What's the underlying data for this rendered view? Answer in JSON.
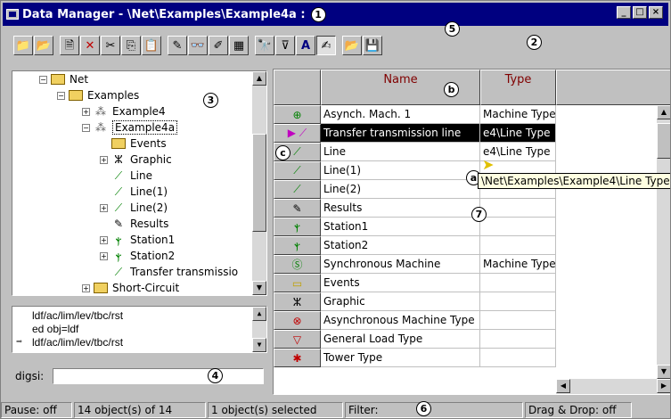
{
  "window": {
    "title": "Data Manager - \\Net\\Examples\\Example4a :",
    "title_callout": "1",
    "controls": [
      "_",
      "□",
      "×"
    ]
  },
  "toolbar": {
    "buttons": [
      {
        "icon": "folder-up-icon",
        "glyph": "📁"
      },
      {
        "icon": "folder-open-icon",
        "glyph": "📂"
      },
      {
        "icon": "new-object-icon",
        "glyph": "🗎"
      },
      {
        "icon": "delete-icon",
        "glyph": "✕"
      },
      {
        "icon": "cut-icon",
        "glyph": "✂"
      },
      {
        "icon": "copy-icon",
        "glyph": "⎘"
      },
      {
        "icon": "paste-icon",
        "glyph": "📋"
      },
      {
        "icon": "edit-icon",
        "glyph": "✎"
      },
      {
        "icon": "detail-view-icon",
        "glyph": "👓"
      },
      {
        "icon": "edit-relevant-icon",
        "glyph": "✐"
      },
      {
        "icon": "calendar-icon",
        "glyph": "▦"
      },
      {
        "icon": "binoculars-icon",
        "glyph": "🔭"
      },
      {
        "icon": "filter-icon",
        "glyph": "⊽"
      },
      {
        "icon": "font-icon",
        "glyph": "A"
      },
      {
        "icon": "script-icon",
        "glyph": "✍"
      },
      {
        "icon": "open-file-icon",
        "glyph": "📂"
      },
      {
        "icon": "save-icon",
        "glyph": "💾"
      }
    ],
    "callout_5": "5",
    "callout_2": "2"
  },
  "tree": {
    "callout": "3",
    "items": [
      {
        "label": "Net",
        "pm": "−",
        "icon": "folder"
      },
      {
        "label": "Examples",
        "pm": "−",
        "icon": "folder"
      },
      {
        "label": "Example4",
        "pm": "+",
        "icon": "grid-icon"
      },
      {
        "label": "Example4a",
        "pm": "−",
        "icon": "grid-icon"
      },
      {
        "label": "Events",
        "pm": "",
        "icon": "folder"
      },
      {
        "label": "Graphic",
        "pm": "+",
        "icon": "graphic-icon"
      },
      {
        "label": "Line",
        "pm": "",
        "icon": "line-icon"
      },
      {
        "label": "Line(1)",
        "pm": "",
        "icon": "line-icon"
      },
      {
        "label": "Line(2)",
        "pm": "+",
        "icon": "line-icon"
      },
      {
        "label": "Results",
        "pm": "",
        "icon": "results-icon"
      },
      {
        "label": "Station1",
        "pm": "+",
        "icon": "station-icon"
      },
      {
        "label": "Station2",
        "pm": "+",
        "icon": "station-icon"
      },
      {
        "label": "Transfer transmissio",
        "pm": "",
        "icon": "line-icon"
      },
      {
        "label": "Short-Circuit",
        "pm": "+",
        "icon": "folder"
      }
    ]
  },
  "command": {
    "lines": [
      "ldf/ac/lim/lev/tbc/rst",
      "ed obj=ldf",
      "ldf/ac/lim/lev/tbc/rst"
    ],
    "digsi_label": "digsi:",
    "digsi_value": "",
    "callout": "4"
  },
  "grid": {
    "headers": {
      "name": "Name",
      "type": "Type"
    },
    "callout_b": "b",
    "callout_c": "c",
    "callout_a": "a",
    "callout_7": "7",
    "rows": [
      {
        "icon": "⊕",
        "icolor": "#008000",
        "name": "Asynch. Mach. 1",
        "type": "Machine Type"
      },
      {
        "icon": "⟋",
        "icolor": "#c000c0",
        "name": "Transfer transmission line",
        "type": "e4\\Line Type",
        "selected": true
      },
      {
        "icon": "⟋",
        "icolor": "#008000",
        "name": "Line",
        "type": "e4\\Line Type"
      },
      {
        "icon": "⟋",
        "icolor": "#008000",
        "name": "Line(1)",
        "type": ""
      },
      {
        "icon": "⟋",
        "icolor": "#008000",
        "name": "Line(2)",
        "type": ""
      },
      {
        "icon": "✎",
        "icolor": "#000000",
        "name": "Results",
        "type": ""
      },
      {
        "icon": "ⲯ",
        "icolor": "#008000",
        "name": "Station1",
        "type": ""
      },
      {
        "icon": "ⲯ",
        "icolor": "#008000",
        "name": "Station2",
        "type": ""
      },
      {
        "icon": "Ⓢ",
        "icolor": "#008000",
        "name": "Synchronous Machine",
        "type": "Machine Type"
      },
      {
        "icon": "▭",
        "icolor": "#c0a000",
        "name": "Events",
        "type": ""
      },
      {
        "icon": "ⵣ",
        "icolor": "#000000",
        "name": "Graphic",
        "type": ""
      },
      {
        "icon": "⊗",
        "icolor": "#c00000",
        "name": "Asynchronous Machine Type",
        "type": ""
      },
      {
        "icon": "▽",
        "icolor": "#c00000",
        "name": "General Load Type",
        "type": ""
      },
      {
        "icon": "✱",
        "icolor": "#c00000",
        "name": "Tower Type",
        "type": ""
      }
    ],
    "tooltip": "\\Net\\Examples\\Example4\\Line Type"
  },
  "status": {
    "pause": "Pause: off",
    "objects": "14 object(s) of 14",
    "selected": "1 object(s) selected",
    "filter": "Filter:",
    "callout": "6",
    "dragdrop": "Drag & Drop: off"
  }
}
